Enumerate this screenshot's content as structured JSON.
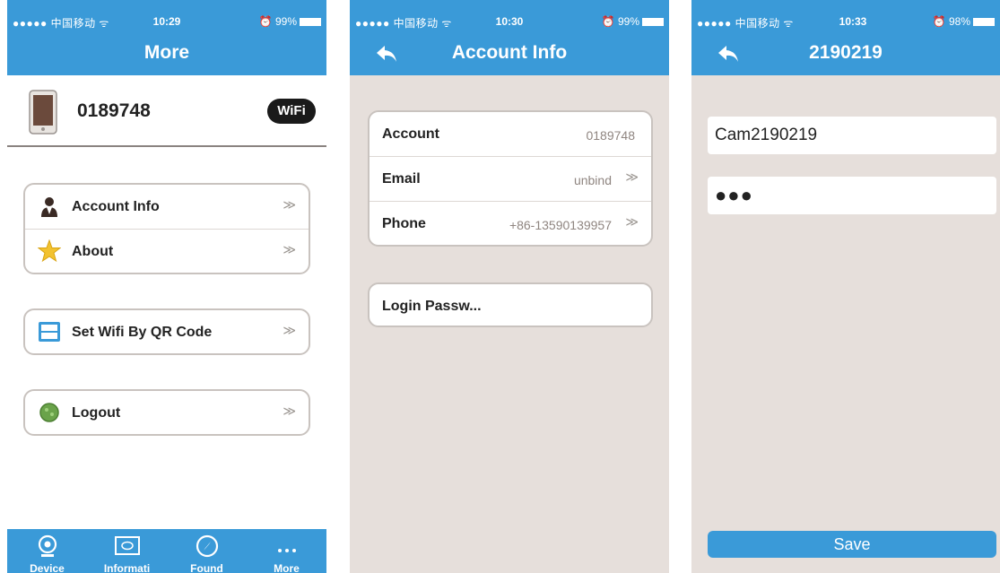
{
  "screens": [
    {
      "status": {
        "carrier": "●●●●● 中国移动 ᯤ",
        "time": "10:29",
        "battery": "⏰ 99%"
      },
      "title": "More",
      "device": {
        "id": "0189748",
        "wifi_badge": "WiFi"
      },
      "menu_groups": [
        {
          "items": [
            {
              "label": "Account Info",
              "icon": "user-icon"
            },
            {
              "label": "About",
              "icon": "star-icon"
            }
          ]
        },
        {
          "items": [
            {
              "label": "Set Wifi By QR Code",
              "icon": "qr-code-icon"
            }
          ]
        },
        {
          "items": [
            {
              "label": "Logout",
              "icon": "logout-icon"
            }
          ]
        }
      ],
      "chevron": "≫",
      "tabs": [
        {
          "label": "Device",
          "icon": "camera-icon"
        },
        {
          "label": "Informati",
          "icon": "monitor-icon"
        },
        {
          "label": "Found",
          "icon": "compass-icon"
        },
        {
          "label": "More",
          "icon": "more-dots-icon"
        }
      ]
    },
    {
      "status": {
        "carrier": "●●●●● 中国移动 ᯤ",
        "time": "10:30",
        "battery": "⏰ 99%"
      },
      "title": "Account Info",
      "rows": [
        {
          "label": "Account",
          "value": "0189748"
        },
        {
          "label": "Email",
          "value": "unbind"
        },
        {
          "label": "Phone",
          "value": "+86-13590139957"
        }
      ],
      "password_row": "Login Passw...",
      "chevron": "≫"
    },
    {
      "status": {
        "carrier": "●●●●● 中国移动 ᯤ",
        "time": "10:33",
        "battery": "⏰ 98%"
      },
      "title": "2190219",
      "name_value": "Cam2190219",
      "password_value": "●●●",
      "save_label": "Save"
    }
  ],
  "colors": {
    "accent": "#3a9ad8",
    "panel_bg": "#e6dfdb",
    "border": "#c9c3bf"
  }
}
